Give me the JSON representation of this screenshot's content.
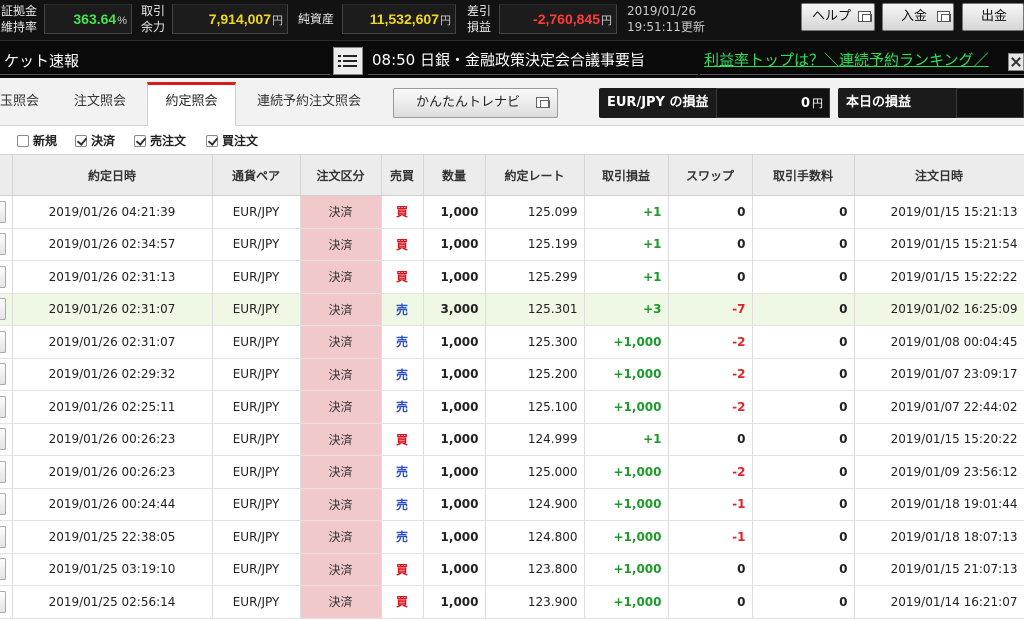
{
  "top_bar": {
    "maintenance_label_line1": "証拠金",
    "maintenance_label_line2": "維持率",
    "maintenance_value": "363.64",
    "maintenance_unit": "%",
    "margin_label_line1": "取引",
    "margin_label_line2": "余力",
    "margin_value": "7,914,007",
    "margin_unit": "円",
    "net_assets_label": "純資産",
    "net_assets_value": "11,532,607",
    "net_assets_unit": "円",
    "diff_label_line1": "差引",
    "diff_label_line2": "損益",
    "diff_value": "-2,760,845",
    "diff_unit": "円",
    "date": "2019/01/26",
    "updated": "19:51:11更新",
    "help_label": "ヘルプ",
    "deposit_label": "入金",
    "withdraw_label": "出金"
  },
  "news_bar": {
    "title": "ケット速報",
    "headline": "08:50 日銀・金融政策決定会合議事要旨",
    "link": "利益率トップは？＼連続予約ランキング／"
  },
  "tabs": [
    {
      "label": "玉照会"
    },
    {
      "label": "注文照会"
    },
    {
      "label": "約定照会"
    },
    {
      "label": "連続予約注文照会"
    }
  ],
  "trenavi_label": "かんたんトレナビ",
  "pl_pair_label": "EUR/JPY の損益",
  "pl_pair_value": "0",
  "pl_pair_unit": "円",
  "pl_today_label": "本日の損益",
  "filters": [
    {
      "label": "新規",
      "checked": false
    },
    {
      "label": "決済",
      "checked": true
    },
    {
      "label": "売注文",
      "checked": true
    },
    {
      "label": "買注文",
      "checked": true
    }
  ],
  "table": {
    "headers": [
      "約定日時",
      "通貨ペア",
      "注文区分",
      "売買",
      "数量",
      "約定レート",
      "取引損益",
      "スワップ",
      "取引手数料",
      "注文日時"
    ],
    "rows": [
      {
        "exec_time": "2019/01/26 04:21:39",
        "pair": "EUR/JPY",
        "kubun": "決済",
        "side": "買",
        "qty": "1,000",
        "rate": "125.099",
        "pl": "+1",
        "swap": "0",
        "fee": "0",
        "order_time": "2019/01/15 15:21:13"
      },
      {
        "exec_time": "2019/01/26 02:34:57",
        "pair": "EUR/JPY",
        "kubun": "決済",
        "side": "買",
        "qty": "1,000",
        "rate": "125.199",
        "pl": "+1",
        "swap": "0",
        "fee": "0",
        "order_time": "2019/01/15 15:21:54"
      },
      {
        "exec_time": "2019/01/26 02:31:13",
        "pair": "EUR/JPY",
        "kubun": "決済",
        "side": "買",
        "qty": "1,000",
        "rate": "125.299",
        "pl": "+1",
        "swap": "0",
        "fee": "0",
        "order_time": "2019/01/15 15:22:22"
      },
      {
        "exec_time": "2019/01/26 02:31:07",
        "pair": "EUR/JPY",
        "kubun": "決済",
        "side": "売",
        "qty": "3,000",
        "rate": "125.301",
        "pl": "+3",
        "swap": "-7",
        "fee": "0",
        "order_time": "2019/01/02 16:25:09"
      },
      {
        "exec_time": "2019/01/26 02:31:07",
        "pair": "EUR/JPY",
        "kubun": "決済",
        "side": "売",
        "qty": "1,000",
        "rate": "125.300",
        "pl": "+1,000",
        "swap": "-2",
        "fee": "0",
        "order_time": "2019/01/08 00:04:45"
      },
      {
        "exec_time": "2019/01/26 02:29:32",
        "pair": "EUR/JPY",
        "kubun": "決済",
        "side": "売",
        "qty": "1,000",
        "rate": "125.200",
        "pl": "+1,000",
        "swap": "-2",
        "fee": "0",
        "order_time": "2019/01/07 23:09:17"
      },
      {
        "exec_time": "2019/01/26 02:25:11",
        "pair": "EUR/JPY",
        "kubun": "決済",
        "side": "売",
        "qty": "1,000",
        "rate": "125.100",
        "pl": "+1,000",
        "swap": "-2",
        "fee": "0",
        "order_time": "2019/01/07 22:44:02"
      },
      {
        "exec_time": "2019/01/26 00:26:23",
        "pair": "EUR/JPY",
        "kubun": "決済",
        "side": "買",
        "qty": "1,000",
        "rate": "124.999",
        "pl": "+1",
        "swap": "0",
        "fee": "0",
        "order_time": "2019/01/15 15:20:22"
      },
      {
        "exec_time": "2019/01/26 00:26:23",
        "pair": "EUR/JPY",
        "kubun": "決済",
        "side": "売",
        "qty": "1,000",
        "rate": "125.000",
        "pl": "+1,000",
        "swap": "-2",
        "fee": "0",
        "order_time": "2019/01/09 23:56:12"
      },
      {
        "exec_time": "2019/01/26 00:24:44",
        "pair": "EUR/JPY",
        "kubun": "決済",
        "side": "売",
        "qty": "1,000",
        "rate": "124.900",
        "pl": "+1,000",
        "swap": "-1",
        "fee": "0",
        "order_time": "2019/01/18 19:01:44"
      },
      {
        "exec_time": "2019/01/25 22:38:05",
        "pair": "EUR/JPY",
        "kubun": "決済",
        "side": "売",
        "qty": "1,000",
        "rate": "124.800",
        "pl": "+1,000",
        "swap": "-1",
        "fee": "0",
        "order_time": "2019/01/18 18:07:13"
      },
      {
        "exec_time": "2019/01/25 03:19:10",
        "pair": "EUR/JPY",
        "kubun": "決済",
        "side": "買",
        "qty": "1,000",
        "rate": "123.800",
        "pl": "+1,000",
        "swap": "0",
        "fee": "0",
        "order_time": "2019/01/15 21:07:13"
      },
      {
        "exec_time": "2019/01/25 02:56:14",
        "pair": "EUR/JPY",
        "kubun": "決済",
        "side": "買",
        "qty": "1,000",
        "rate": "123.900",
        "pl": "+1,000",
        "swap": "0",
        "fee": "0",
        "order_time": "2019/01/14 16:21:07"
      }
    ]
  },
  "colors": {
    "buy": "#d8141e",
    "sell": "#2c4ec8",
    "profit": "#1d9a2b",
    "loss": "#e2222c",
    "kubun_bg": "#f1c9cb",
    "active_tab_accent": "#d81c1c",
    "link_green": "#28e05a"
  },
  "icons": {
    "window_popup": "window-popup-icon",
    "news_list": "list-icon",
    "close": "close-icon"
  }
}
